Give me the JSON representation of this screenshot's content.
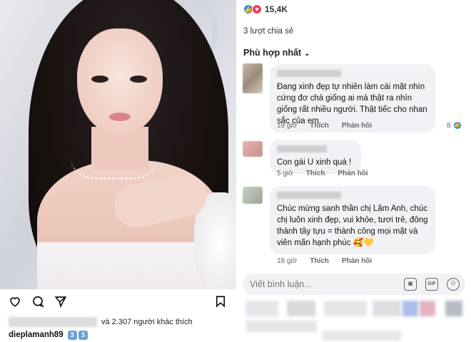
{
  "instagram": {
    "liked_by_suffix": "và 2.307 người khác thích",
    "username": "dieplamanh89",
    "caption_emojis": [
      "3",
      "3"
    ]
  },
  "facebook": {
    "reaction_count": "15,4K",
    "shares": "3 lượt chia sẻ",
    "sort_label": "Phù hợp nhất",
    "comments": [
      {
        "text": "Đang xinh đẹp tự nhiên làm cái mặt nhìn cứng đơ chà giống ai mà thật ra nhìn giống rất nhiều người. Thật tiếc cho nhan sắc của em.",
        "time": "19 giờ",
        "like": "Thích",
        "reply": "Phản hồi",
        "reactions": "8"
      },
      {
        "text": "Con gái U xinh quá !",
        "time": "5 giờ",
        "like": "Thích",
        "reply": "Phản hồi"
      },
      {
        "text": "Chúc mừng sanh thần chị Lâm Anh, chúc chị luôn xinh đẹp, vui khỏe, tươi trẻ, đông thành tây tựu = thành công mọi mặt và viên mãn hạnh phúc 🥰💛",
        "time": "18 giờ",
        "like": "Thích",
        "reply": "Phản hồi"
      }
    ],
    "composer_placeholder": "Viết bình luận...",
    "composer_gif": "GIF"
  },
  "colors": {
    "fb_bubble": "#f0f2f5",
    "fb_like": "#2d88ff",
    "fb_love": "#f33e58",
    "meta_gray": "#65676b"
  }
}
